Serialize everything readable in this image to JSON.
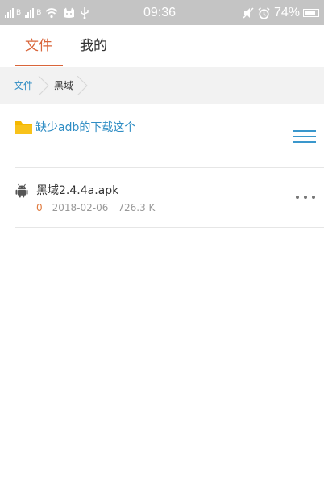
{
  "status_bar": {
    "sim_label": "B",
    "time": "09:36",
    "battery_text": "74%",
    "icons": [
      "signal-icon",
      "wifi-icon",
      "cat-icon",
      "usb-icon",
      "mute-icon",
      "alarm-icon",
      "battery-icon"
    ]
  },
  "tabs": [
    {
      "label": "文件",
      "active": true
    },
    {
      "label": "我的",
      "active": false
    }
  ],
  "breadcrumb": {
    "root": "文件",
    "current": "黑域"
  },
  "folder": {
    "name": "缺少adb的下载这个"
  },
  "files": [
    {
      "name": "黑域2.4.4a.apk",
      "count": "0",
      "date": "2018-02-06",
      "size": "726.3 K"
    }
  ],
  "colors": {
    "accent": "#d9653a",
    "link": "#2f8dc4",
    "folder": "#f5b800",
    "status_bar": "#c4c4c4"
  }
}
